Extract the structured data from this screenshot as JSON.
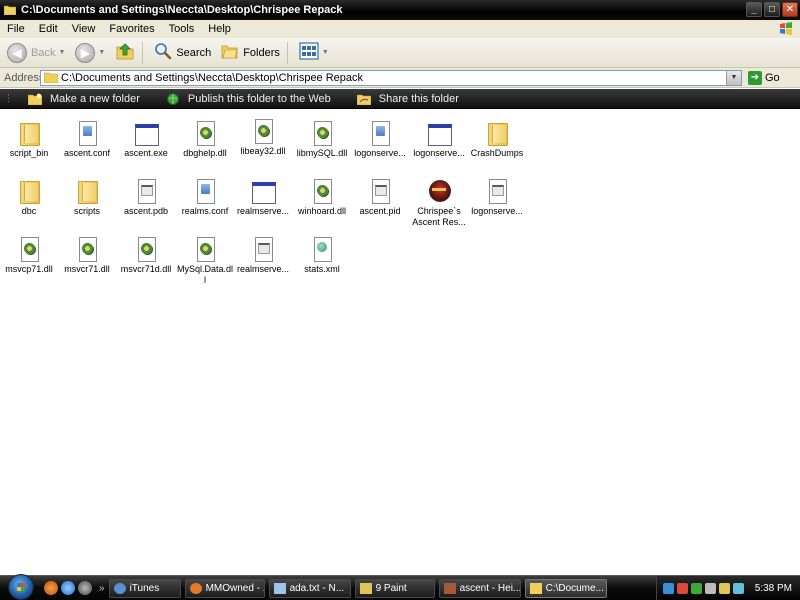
{
  "window": {
    "title": "C:\\Documents and Settings\\Neccta\\Desktop\\Chrispee Repack",
    "minimize_label": "_",
    "maximize_label": "□",
    "close_label": "✕"
  },
  "menu": [
    "File",
    "Edit",
    "View",
    "Favorites",
    "Tools",
    "Help"
  ],
  "toolbar": {
    "back_label": "Back",
    "search_label": "Search",
    "folders_label": "Folders"
  },
  "address": {
    "label": "Address",
    "value": "C:\\Documents and Settings\\Neccta\\Desktop\\Chrispee Repack",
    "go_label": "Go"
  },
  "tasks": [
    {
      "label": "Make a new folder",
      "icon": "new-folder-icon"
    },
    {
      "label": "Publish this folder to the Web",
      "icon": "globe-icon"
    },
    {
      "label": "Share this folder",
      "icon": "share-folder-icon"
    }
  ],
  "files": [
    {
      "name": "script_bin",
      "type": "folder"
    },
    {
      "name": "ascent.conf",
      "type": "doc"
    },
    {
      "name": "ascent.exe",
      "type": "exe"
    },
    {
      "name": "dbghelp.dll",
      "type": "dll"
    },
    {
      "name": "libeay32.dll",
      "type": "dll"
    },
    {
      "name": "libmySQL.dll",
      "type": "dll"
    },
    {
      "name": "logonserve...",
      "type": "doc"
    },
    {
      "name": "logonserve...",
      "type": "exe"
    },
    {
      "name": "CrashDumps",
      "type": "folder"
    },
    {
      "name": "dbc",
      "type": "folder"
    },
    {
      "name": "scripts",
      "type": "folder"
    },
    {
      "name": "ascent.pdb",
      "type": "txt"
    },
    {
      "name": "realms.conf",
      "type": "doc"
    },
    {
      "name": "realmserve...",
      "type": "exe"
    },
    {
      "name": "winhoard.dll",
      "type": "dll"
    },
    {
      "name": "ascent.pid",
      "type": "txt"
    },
    {
      "name": "Chrispee`s Ascent Res...",
      "type": "app"
    },
    {
      "name": "logonserve...",
      "type": "txt"
    },
    {
      "name": "msvcp71.dll",
      "type": "dll"
    },
    {
      "name": "msvcr71.dll",
      "type": "dll"
    },
    {
      "name": "msvcr71d.dll",
      "type": "dll"
    },
    {
      "name": "MySql.Data.dll",
      "type": "dll"
    },
    {
      "name": "realmserve...",
      "type": "txt"
    },
    {
      "name": "stats.xml",
      "type": "xml"
    }
  ],
  "taskbar": {
    "buttons": [
      {
        "label": "iTunes",
        "icon": "itunes-icon",
        "color": "#5b8fd6"
      },
      {
        "label": "MMOwned - ...",
        "icon": "firefox-icon",
        "color": "#e07a2a"
      },
      {
        "label": "ada.txt - N...",
        "icon": "notepad-icon",
        "color": "#9fc4ea"
      },
      {
        "label": "9 Paint",
        "icon": "paint-icon",
        "color": "#e0c45a"
      },
      {
        "label": "ascent - Hei...",
        "icon": "ascent-icon",
        "color": "#a45a3a"
      },
      {
        "label": "C:\\Docume...",
        "icon": "folder-icon",
        "color": "#f0cf5a"
      }
    ],
    "clock": "5:38 PM"
  },
  "colors": {
    "titlebar": "#000000",
    "taskstrip": "#1a1a1a",
    "accent": "#2a3fa8"
  }
}
